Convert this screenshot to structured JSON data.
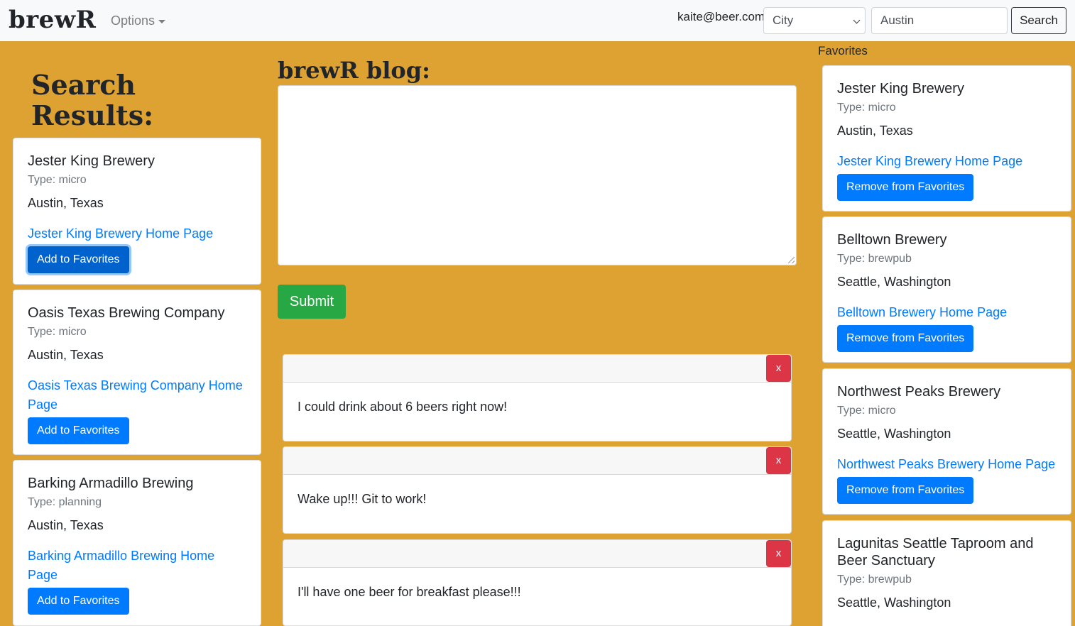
{
  "navbar": {
    "brand": "brewR",
    "options_label": "Options",
    "user_email": "kaite@beer.com",
    "search_type": "City",
    "search_value": "Austin",
    "search_button": "Search"
  },
  "results": {
    "heading_line1": "Search",
    "heading_line2": "Results:",
    "items": [
      {
        "name": "Jester King Brewery",
        "type": "Type: micro",
        "location": "Austin, Texas",
        "link": "Jester King Brewery Home Page",
        "button": "Add to Favorites"
      },
      {
        "name": "Oasis Texas Brewing Company",
        "type": "Type: micro",
        "location": "Austin, Texas",
        "link": "Oasis Texas Brewing Company Home Page",
        "button": "Add to Favorites"
      },
      {
        "name": "Barking Armadillo Brewing",
        "type": "Type: planning",
        "location": "Austin, Texas",
        "link": "Barking Armadillo Brewing Home Page",
        "button": "Add to Favorites"
      }
    ]
  },
  "blog": {
    "heading": "brewR blog:",
    "textarea_value": "",
    "submit_label": "Submit",
    "posts": [
      {
        "text": "I could drink about 6 beers right now!",
        "delete_label": "x"
      },
      {
        "text": "Wake up!!! Git to work!",
        "delete_label": "x"
      },
      {
        "text": "I'll have one beer for breakfast please!!!",
        "delete_label": "x"
      }
    ]
  },
  "favorites": {
    "heading": "Favorites",
    "items": [
      {
        "name": "Jester King Brewery",
        "type": "Type: micro",
        "location": "Austin, Texas",
        "link": "Jester King Brewery Home Page",
        "button": "Remove from Favorites"
      },
      {
        "name": "Belltown Brewery",
        "type": "Type: brewpub",
        "location": "Seattle, Washington",
        "link": "Belltown Brewery Home Page",
        "button": "Remove from Favorites"
      },
      {
        "name": "Northwest Peaks Brewery",
        "type": "Type: micro",
        "location": "Seattle, Washington",
        "link": "Northwest Peaks Brewery Home Page",
        "button": "Remove from Favorites"
      },
      {
        "name": "Lagunitas Seattle Taproom and Beer Sanctuary",
        "type": "Type: brewpub",
        "location": "Seattle, Washington"
      }
    ]
  },
  "colors": {
    "background": "#DDA232",
    "primary": "#007bff",
    "success": "#28a745",
    "danger": "#dc3545"
  }
}
